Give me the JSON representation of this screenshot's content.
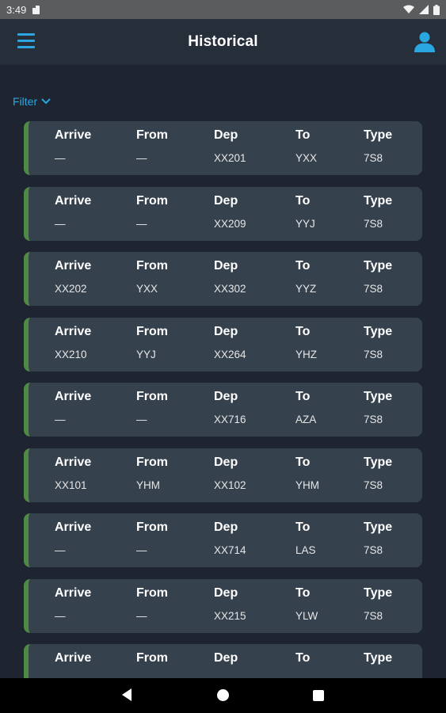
{
  "status_bar": {
    "time": "3:49"
  },
  "app_bar": {
    "title": "Historical"
  },
  "filter": {
    "label": "Filter"
  },
  "columns": {
    "arrive": "Arrive",
    "from": "From",
    "dep": "Dep",
    "to": "To",
    "type": "Type"
  },
  "accent_color": "#4f8a44",
  "link_color": "#2aa6e0",
  "flights": [
    {
      "arrive": "—",
      "from": "—",
      "dep": "XX201",
      "to": "YXX",
      "type": "7S8"
    },
    {
      "arrive": "—",
      "from": "—",
      "dep": "XX209",
      "to": "YYJ",
      "type": "7S8"
    },
    {
      "arrive": "XX202",
      "from": "YXX",
      "dep": "XX302",
      "to": "YYZ",
      "type": "7S8"
    },
    {
      "arrive": "XX210",
      "from": "YYJ",
      "dep": "XX264",
      "to": "YHZ",
      "type": "7S8"
    },
    {
      "arrive": "—",
      "from": "—",
      "dep": "XX716",
      "to": "AZA",
      "type": "7S8"
    },
    {
      "arrive": "XX101",
      "from": "YHM",
      "dep": "XX102",
      "to": "YHM",
      "type": "7S8"
    },
    {
      "arrive": "—",
      "from": "—",
      "dep": "XX714",
      "to": "LAS",
      "type": "7S8"
    },
    {
      "arrive": "—",
      "from": "—",
      "dep": "XX215",
      "to": "YLW",
      "type": "7S8"
    },
    {
      "arrive": "",
      "from": "",
      "dep": "",
      "to": "",
      "type": ""
    }
  ]
}
